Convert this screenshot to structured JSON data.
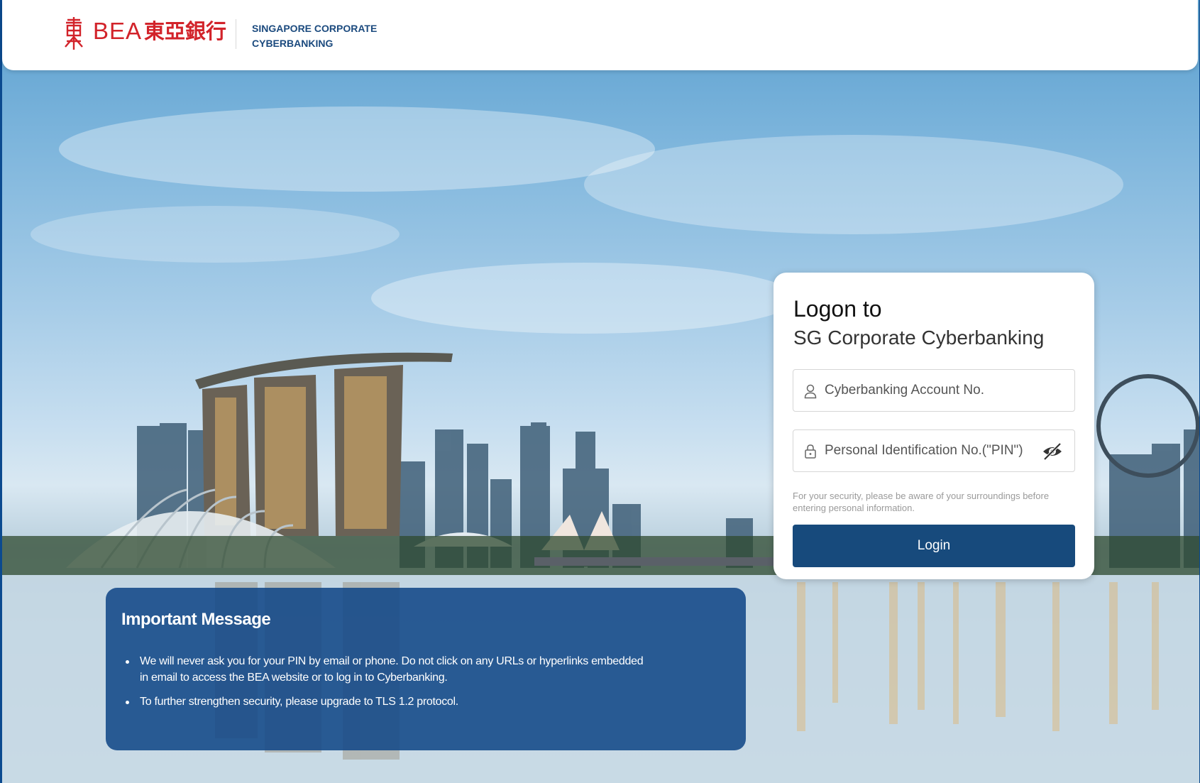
{
  "header": {
    "logo_text": "BEA",
    "logo_cjk": "東亞銀行",
    "subtitle_line1": "SINGAPORE CORPORATE",
    "subtitle_line2": "CYBERBANKING",
    "logo_icon": "bea-emblem-icon",
    "brand_color": "#d2232a"
  },
  "login": {
    "title": "Logon to",
    "subtitle": "SG Corporate Cyberbanking",
    "account_placeholder": "Cyberbanking Account No.",
    "account_value": "",
    "account_icon": "user-icon",
    "pin_placeholder": "Personal Identification No.(\"PIN\")",
    "pin_value": "",
    "pin_icon": "lock-icon",
    "visibility_icon": "eye-slash-icon",
    "security_note": "For your security, please be aware of your surroundings before entering personal information.",
    "button_label": "Login",
    "button_color": "#174a7c"
  },
  "message": {
    "title": "Important Message",
    "items": [
      "We will never ask you for your PIN by email or phone. Do not click on any URLs or hyperlinks embedded in email to access the BEA website or to log in to Cyberbanking.",
      "To further strengthen security, please upgrade to TLS 1.2 protocol."
    ]
  }
}
